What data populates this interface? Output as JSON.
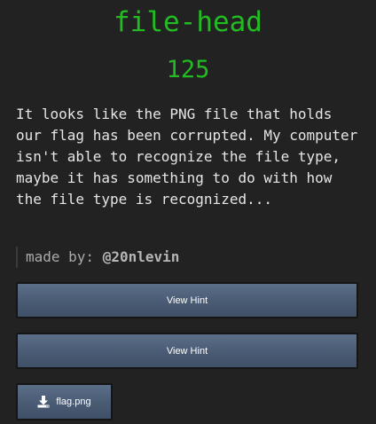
{
  "challenge": {
    "title": "file-head",
    "points": "125",
    "description": "It looks like the PNG file that holds our flag has been corrupted. My computer isn't able to recognize the file type, maybe it has something to do with how the file type is recognized...",
    "author_prefix": "made by: ",
    "author_handle": "@20nlevin"
  },
  "hints": [
    {
      "label": "View Hint"
    },
    {
      "label": "View Hint"
    }
  ],
  "files": [
    {
      "name": "flag.png",
      "icon": "download-icon"
    }
  ],
  "colors": {
    "background": "#222222",
    "title": "#22bb22",
    "text": "#e6e6e6",
    "button": "#4a5b74"
  }
}
